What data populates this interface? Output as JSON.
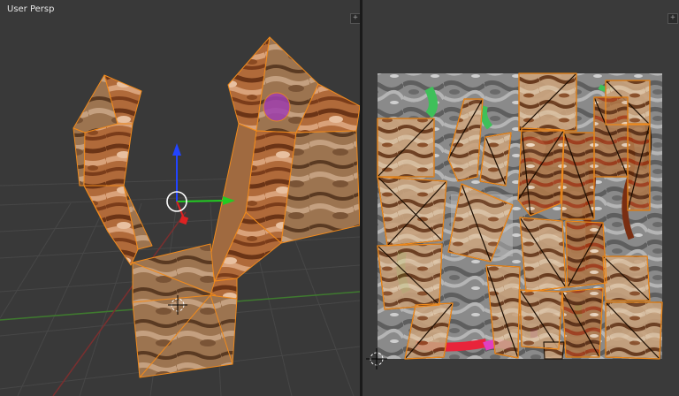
{
  "viewport3d": {
    "label": "User Persp",
    "corner_widget": "+"
  },
  "uv_editor": {
    "corner_widget": "+"
  },
  "colors": {
    "selection_edge": "#f08a1c",
    "grid_line": "#474747",
    "x_axis": "#7a2f2f",
    "y_axis": "#3f7a2f",
    "gizmo_z": "#2244ff",
    "gizmo_y": "#22cc22",
    "gizmo_x": "#dd2222"
  }
}
